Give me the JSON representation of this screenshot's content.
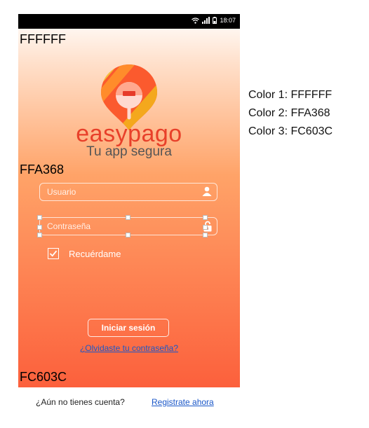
{
  "status_bar": {
    "time": "18:07",
    "icons": [
      "wifi-icon",
      "signal-icon",
      "battery-icon"
    ]
  },
  "palette_labels": {
    "top": "FFFFFF",
    "middle": "FFA368",
    "bottom": "FC603C"
  },
  "brand": {
    "name": "easypago",
    "tagline": "Tu app segura"
  },
  "form": {
    "username_placeholder": "Usuario",
    "password_placeholder": "Contraseña",
    "remember_label": "Recuérdame",
    "remember_checked": true,
    "login_button": "Iniciar sesión",
    "forgot_link": "¿Olvidaste tu contraseña?"
  },
  "footer": {
    "question": "¿Aún no tienes cuenta?",
    "register_link": "Registrate ahora"
  },
  "legend": [
    "Color 1: FFFFFF",
    "Color 2: FFA368",
    "Color 3: FC603C"
  ],
  "colors": {
    "white": "#FFFFFF",
    "mid": "#FFA368",
    "bottom": "#FC603C",
    "link": "#1A57C8"
  }
}
